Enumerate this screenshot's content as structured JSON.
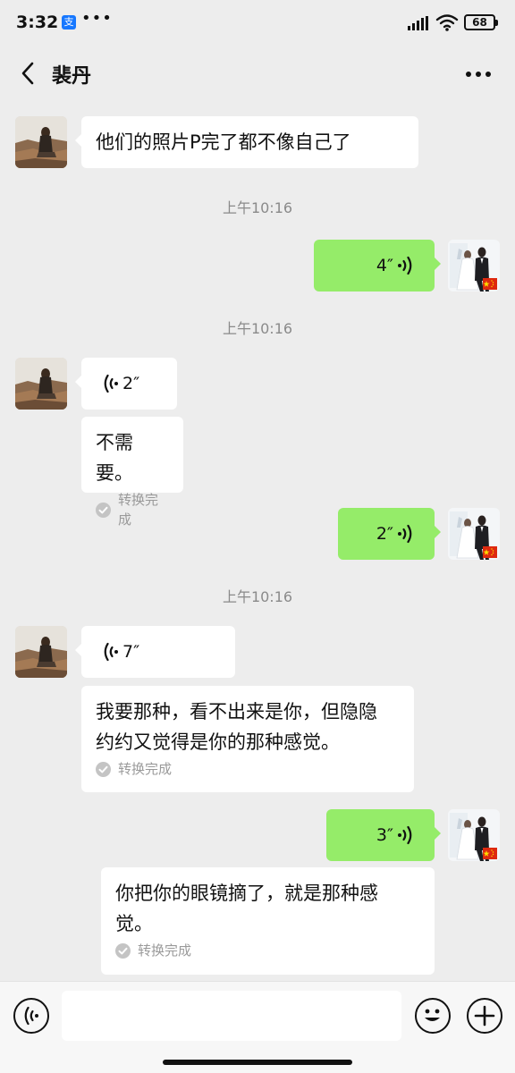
{
  "status_bar": {
    "time": "3:32",
    "app_icon_glyph": "支",
    "dots": "•••",
    "battery": "68"
  },
  "header": {
    "title": "裴丹"
  },
  "messages": [
    {
      "type": "text",
      "from": "contact",
      "text": "他们的照片P完了都不像自己了"
    },
    {
      "type": "time",
      "text": "上午10:16"
    },
    {
      "type": "voice",
      "from": "me",
      "duration": "4″"
    },
    {
      "type": "time",
      "text": "上午10:16"
    },
    {
      "type": "voice",
      "from": "contact",
      "duration": "2″",
      "transcript": "不需要。",
      "transcript_status": "转换完成"
    },
    {
      "type": "voice",
      "from": "me",
      "duration": "2″"
    },
    {
      "type": "time",
      "text": "上午10:16"
    },
    {
      "type": "voice",
      "from": "contact",
      "duration": "7″",
      "transcript_lines": [
        "我要那种，看不出来是你，但隐隐",
        "约约又觉得是你的那种感觉。"
      ],
      "transcript_status": "转换完成"
    },
    {
      "type": "voice",
      "from": "me",
      "duration": "3″",
      "transcript_lines": [
        "你把你的眼镜摘了，就是那种感",
        "觉。"
      ],
      "transcript_status": "转换完成"
    }
  ],
  "colors": {
    "background": "#ededed",
    "outgoing_bubble": "#95ec69",
    "incoming_bubble": "#ffffff",
    "muted_text": "#8a8a8a"
  },
  "icons": {
    "back": "chevron-left-icon",
    "more": "more-dots-icon",
    "voice_wave": "voice-wave-icon",
    "voice_toggle": "voice-mode-icon",
    "emoji": "smiley-icon",
    "plus": "plus-icon",
    "check": "check-circle-icon",
    "flag": "china-flag-icon"
  }
}
